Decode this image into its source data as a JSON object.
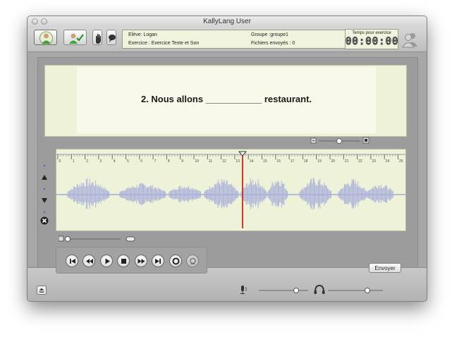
{
  "window": {
    "title": "KallyLang User"
  },
  "toolbar": {
    "student_label": "Elève:",
    "student_value": "Logan",
    "exercise_label": "Exercice :",
    "exercise_value": "Exercice Texte et Son",
    "group_label": "Groupe :",
    "group_value": "groupe1",
    "files_label": "Fichiers envoyés :",
    "files_value": "0"
  },
  "timer": {
    "label": "Temps pour exercice",
    "value": "00:00:00"
  },
  "question": {
    "text": "2. Nous allons ___________ restaurant."
  },
  "timeline": {
    "ticks": [
      "0",
      "1",
      "2",
      "3",
      "4",
      "5",
      "6",
      "7",
      "8",
      "9",
      "10",
      "11",
      "12",
      "13",
      "14",
      "15",
      "16",
      "17",
      "18",
      "19",
      "20",
      "21",
      "22",
      "23",
      "24",
      "25"
    ],
    "playhead_seconds": 13.6
  },
  "transport": {
    "buttons": [
      "skip-back",
      "rewind",
      "play",
      "stop",
      "fast-forward",
      "skip-forward",
      "record",
      "record-disabled"
    ]
  },
  "actions": {
    "send_label": "Envoyer"
  },
  "icons": [
    "user-icon",
    "user-check-icon",
    "hand-icon",
    "speech-bubble-icon",
    "users-icon",
    "eject-icon",
    "microphone-icon",
    "headphones-icon",
    "zoom-out-icon",
    "zoom-in-icon",
    "up-arrow-icon",
    "down-arrow-icon",
    "delete-icon"
  ],
  "colors": {
    "panel": "#eef2d9",
    "playhead": "#d9362e",
    "waveform": "#aab0d9"
  }
}
